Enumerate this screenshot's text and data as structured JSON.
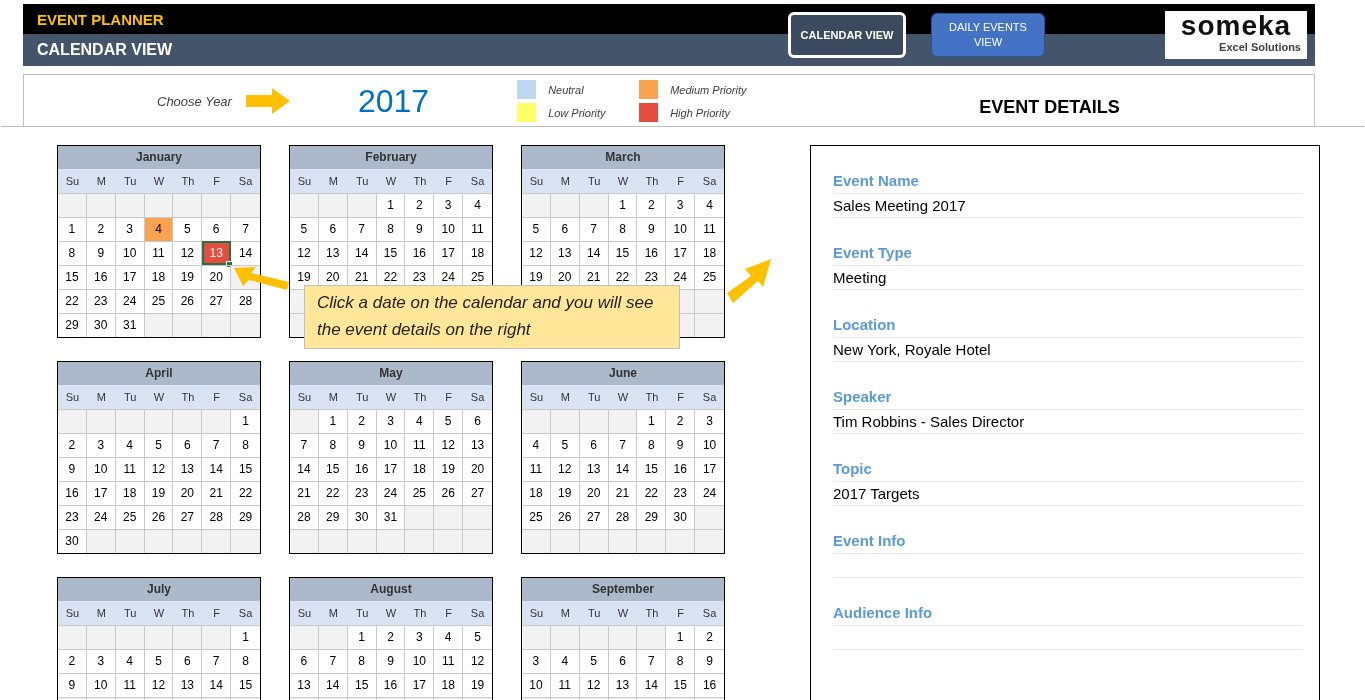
{
  "header": {
    "title": "EVENT PLANNER",
    "subtitle": "CALENDAR VIEW",
    "buttons": [
      {
        "label": "CALENDAR VIEW",
        "selected": true
      },
      {
        "label": "DAILY EVENTS VIEW",
        "selected": false
      }
    ],
    "logo": {
      "name": "someka",
      "tagline": "Excel Solutions"
    }
  },
  "year_picker": {
    "label": "Choose Year",
    "value": "2017"
  },
  "legend": [
    {
      "label": "Neutral",
      "color": "#bdd7ee"
    },
    {
      "label": "Medium Priority",
      "color": "#f9a350"
    },
    {
      "label": "Low Priority",
      "color": "#ffff66"
    },
    {
      "label": "High Priority",
      "color": "#e84c3d"
    }
  ],
  "months": [
    {
      "name": "January",
      "weekdays": [
        "Su",
        "M",
        "Tu",
        "W",
        "Th",
        "F",
        "Sa"
      ],
      "weeks": [
        {
          "kind": "blank"
        },
        {
          "kind": "week",
          "days": [
            "1",
            "2",
            "3",
            {
              "day": "4",
              "color": "#f9a350",
              "selected": false
            },
            "5",
            "6",
            "7"
          ]
        },
        {
          "kind": "week",
          "days": [
            "8",
            "9",
            "10",
            "11",
            "12",
            {
              "day": "13",
              "color": "#e84c3d",
              "selected": true
            },
            "14"
          ]
        },
        {
          "kind": "week",
          "days": [
            "15",
            "16",
            "17",
            "18",
            "19",
            "20"
          ]
        },
        {
          "kind": "week",
          "days": [
            "22",
            "23",
            "24",
            "25",
            "26",
            "27",
            "28"
          ]
        },
        {
          "kind": "week",
          "days": [
            "29",
            "30",
            "31"
          ]
        }
      ]
    },
    {
      "name": "February",
      "weekdays": [
        "Su",
        "M",
        "Tu",
        "W",
        "Th",
        "F",
        "Sa"
      ],
      "weeks": [
        {
          "kind": "first",
          "days": [
            "1",
            "2",
            "3",
            "4"
          ]
        },
        {
          "kind": "week",
          "days": [
            "5",
            "6",
            "7",
            "8",
            "9",
            "10",
            "11"
          ]
        },
        {
          "kind": "week",
          "days": [
            "12",
            "13",
            "14",
            "15",
            "16",
            "17",
            "18"
          ]
        },
        {
          "kind": "week",
          "days": [
            "19",
            "20",
            "21",
            "22",
            "23",
            "24",
            "25"
          ]
        }
      ]
    },
    {
      "name": "March",
      "weekdays": [
        "Su",
        "M",
        "Tu",
        "W",
        "Th",
        "F",
        "Sa"
      ],
      "weeks": [
        {
          "kind": "first",
          "days": [
            "1",
            "2",
            "3",
            "4"
          ]
        },
        {
          "kind": "week",
          "days": [
            "5",
            "6",
            "7",
            "8",
            "9",
            "10",
            "11"
          ]
        },
        {
          "kind": "week",
          "days": [
            "12",
            "13",
            "14",
            "15",
            "16",
            "17",
            "18"
          ]
        },
        {
          "kind": "week",
          "days": [
            "19",
            "20",
            "21",
            "22",
            "23",
            "24",
            "25"
          ]
        }
      ]
    },
    {
      "name": "April",
      "weekdays": [
        "Su",
        "M",
        "Tu",
        "W",
        "Th",
        "F",
        "Sa"
      ],
      "weeks": [
        {
          "kind": "first",
          "days": [
            "1"
          ]
        },
        {
          "kind": "week",
          "days": [
            "2",
            "3",
            "4",
            "5",
            "6",
            "7",
            "8"
          ]
        },
        {
          "kind": "week",
          "days": [
            "9",
            "10",
            "11",
            "12",
            "13",
            "14",
            "15"
          ]
        },
        {
          "kind": "week",
          "days": [
            "16",
            "17",
            "18",
            "19",
            "20",
            "21",
            "22"
          ]
        },
        {
          "kind": "week",
          "days": [
            "23",
            "24",
            "25",
            "26",
            "27",
            "28",
            "29"
          ]
        },
        {
          "kind": "week",
          "days": [
            "30"
          ]
        }
      ]
    },
    {
      "name": "May",
      "weekdays": [
        "Su",
        "M",
        "Tu",
        "W",
        "Th",
        "F",
        "Sa"
      ],
      "weeks": [
        {
          "kind": "first",
          "days": [
            "1",
            "2",
            "3",
            "4",
            "5",
            "6"
          ]
        },
        {
          "kind": "week",
          "days": [
            "7",
            "8",
            "9",
            "10",
            "11",
            "12",
            "13"
          ]
        },
        {
          "kind": "week",
          "days": [
            "14",
            "15",
            "16",
            "17",
            "18",
            "19",
            "20"
          ]
        },
        {
          "kind": "week",
          "days": [
            "21",
            "22",
            "23",
            "24",
            "25",
            "26",
            "27"
          ]
        },
        {
          "kind": "week",
          "days": [
            "28",
            "29",
            "30",
            "31"
          ]
        }
      ]
    },
    {
      "name": "June",
      "weekdays": [
        "Su",
        "M",
        "Tu",
        "W",
        "Th",
        "F",
        "Sa"
      ],
      "weeks": [
        {
          "kind": "first",
          "days": [
            "1",
            "2",
            "3"
          ]
        },
        {
          "kind": "week",
          "days": [
            "4",
            "5",
            "6",
            "7",
            "8",
            "9",
            "10"
          ]
        },
        {
          "kind": "week",
          "days": [
            "11",
            "12",
            "13",
            "14",
            "15",
            "16",
            "17"
          ]
        },
        {
          "kind": "week",
          "days": [
            "18",
            "19",
            "20",
            "21",
            "22",
            "23",
            "24"
          ]
        },
        {
          "kind": "week",
          "days": [
            "25",
            "26",
            "27",
            "28",
            "29",
            "30"
          ]
        }
      ]
    },
    {
      "name": "July",
      "weekdays": [
        "Su",
        "M",
        "Tu",
        "W",
        "Th",
        "F",
        "Sa"
      ],
      "weeks": [
        {
          "kind": "first",
          "days": [
            "1"
          ]
        },
        {
          "kind": "week",
          "days": [
            "2",
            "3",
            "4",
            "5",
            "6",
            "7",
            "8"
          ]
        },
        {
          "kind": "week",
          "days": [
            "9",
            "10",
            "11",
            "12",
            "13",
            "14",
            "15"
          ]
        }
      ]
    },
    {
      "name": "August",
      "weekdays": [
        "Su",
        "M",
        "Tu",
        "W",
        "Th",
        "F",
        "Sa"
      ],
      "weeks": [
        {
          "kind": "first",
          "days": [
            "1",
            "2",
            "3",
            "4",
            "5"
          ]
        },
        {
          "kind": "week",
          "days": [
            "6",
            "7",
            "8",
            "9",
            "10",
            "11",
            "12"
          ]
        },
        {
          "kind": "week",
          "days": [
            "13",
            "14",
            "15",
            "16",
            "17",
            "18",
            "19"
          ]
        }
      ]
    },
    {
      "name": "September",
      "weekdays": [
        "Su",
        "M",
        "Tu",
        "W",
        "Th",
        "F",
        "Sa"
      ],
      "weeks": [
        {
          "kind": "first",
          "days": [
            "1",
            "2"
          ]
        },
        {
          "kind": "week",
          "days": [
            "3",
            "4",
            "5",
            "6",
            "7",
            "8",
            "9"
          ]
        },
        {
          "kind": "week",
          "days": [
            "10",
            "11",
            "12",
            "13",
            "14",
            "15",
            "16"
          ]
        }
      ]
    }
  ],
  "callout": {
    "text": "Click a date on the calendar and you will see the event details on the right"
  },
  "event_details": {
    "title": "EVENT DETAILS",
    "fields": [
      {
        "label": "Event Name",
        "value": "Sales Meeting 2017"
      },
      {
        "label": "Event Type",
        "value": "Meeting"
      },
      {
        "label": "Location",
        "value": "New York, Royale Hotel"
      },
      {
        "label": "Speaker",
        "value": "Tim Robbins - Sales Director"
      },
      {
        "label": "Topic",
        "value": "2017 Targets"
      },
      {
        "label": "Event Info"
      },
      {
        "label": "Audience Info"
      }
    ]
  }
}
